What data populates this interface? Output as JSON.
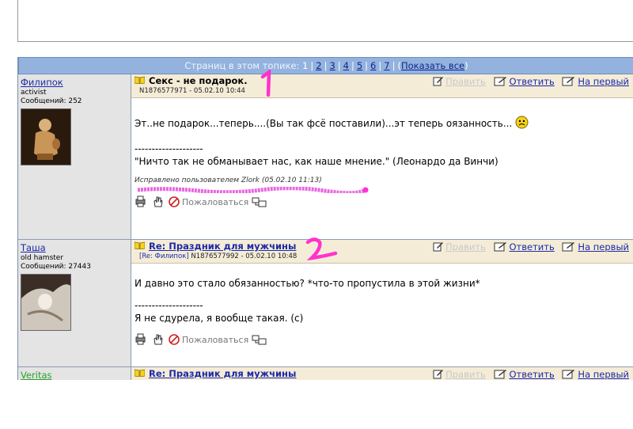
{
  "pager": {
    "label": "Страниц в этом топике:",
    "pages": [
      "1",
      "2",
      "3",
      "4",
      "5",
      "6",
      "7"
    ],
    "show_all": "Показать все",
    "open_paren": "(",
    "close_paren": ")"
  },
  "posts": [
    {
      "author": "Филипок",
      "rank": "activist",
      "messages": "Сообщений: 252",
      "title": "Секс - не подарок.",
      "meta": "N1876577971 - 05.02.10 10:44",
      "actions": {
        "edit": "Править",
        "reply": "Ответить",
        "first": "На первый"
      },
      "text1": "Эт..не подарок...теперь....(Вы так фсё поставили)...эт теперь оязанность...",
      "separator": "--------------------",
      "signature": "\"Ничто так не обманывает нас, как наше мнение.\" (Леонардо да Винчи)",
      "edited": "Исправлено пользователем Zlork (05.02.10 11:13)",
      "complain": "Пожаловаться",
      "annotation": "1"
    },
    {
      "author": "Таша",
      "rank": "old hamster",
      "messages": "Сообщений: 27443",
      "title": "Re: Праздник для мужчины",
      "reply_to": "[Re: Филипок]",
      "meta": "N1876577992 - 05.02.10 10:48",
      "actions": {
        "edit": "Править",
        "reply": "Ответить",
        "first": "На первый"
      },
      "text1": "И давно это стало обязанностью? *что-то пропустила в этой жизни*",
      "separator": "--------------------",
      "signature": "Я не сдурела, я вообще такая. (с)",
      "complain": "Пожаловаться",
      "annotation": "2"
    },
    {
      "author": "Veritas",
      "title": "Re: Праздник для мужчины",
      "actions": {
        "edit": "Править",
        "reply": "Ответить",
        "first": "На первый"
      }
    }
  ],
  "colors": {
    "pager_bg": "#93b3de",
    "header_bg": "#f5ecd8",
    "link": "#1a2aa8",
    "annotation": "#ff33cc"
  }
}
